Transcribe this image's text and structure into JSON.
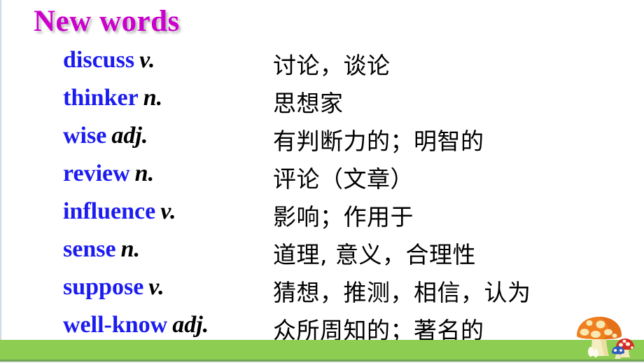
{
  "slide": {
    "title": "New words",
    "title_color": "#cc00cc",
    "word_color": "#1c1cf0",
    "pos_color": "#000000",
    "band_color": "#8dcd51",
    "background_color": "#ffffff"
  },
  "entries": [
    {
      "word": "discuss",
      "pos": "v.",
      "meaning": "讨论，谈论"
    },
    {
      "word": "thinker",
      "pos": "n.",
      "meaning": "思想家"
    },
    {
      "word": "wise",
      "pos": "adj.",
      "meaning": "有判断力的；明智的"
    },
    {
      "word": "review",
      "pos": "n.",
      "meaning": "评论（文章）"
    },
    {
      "word": "influence",
      "pos": "v.",
      "meaning": "影响；作用于"
    },
    {
      "word": "sense",
      "pos": "n.",
      "meaning": "道理, 意义，合理性"
    },
    {
      "word": "suppose",
      "pos": "v.",
      "meaning": "猜想，推测，相信，认为"
    },
    {
      "word": "well-know",
      "pos": "adj.",
      "meaning": "众所周知的；著名的"
    }
  ],
  "decoration": {
    "mushrooms_icon": "mushrooms-icon",
    "big_cap_color": "#f07d1e",
    "big_spot_color": "#f7e3a6",
    "small_cap_color": "#d62b23",
    "small_blue_color": "#2f5fbf"
  }
}
